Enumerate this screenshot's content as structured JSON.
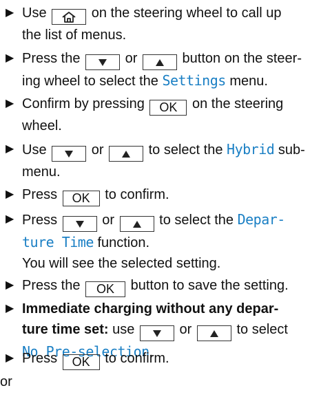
{
  "steps": [
    {
      "a": "Use",
      "b": "on the steering wheel to call up",
      "c": "the list of menus."
    },
    {
      "a": "Press the",
      "or": "or",
      "b": "button on the steer-",
      "c": "ing wheel to select the",
      "ui": "Settings",
      "d": "menu."
    },
    {
      "a": "Confirm by pressing",
      "ok": "OK",
      "b": "on the steering",
      "c": "wheel."
    },
    {
      "a": "Use",
      "or": "or",
      "b": "to select the",
      "ui": "Hybrid",
      "c": "sub-",
      "d": "menu."
    },
    {
      "a": "Press",
      "ok": "OK",
      "b": "to confirm."
    },
    {
      "a": "Press",
      "or": "or",
      "b": "to select the",
      "ui1": "Depar-",
      "ui2": "ture Time",
      "c": "function.",
      "d": "You will see the selected setting."
    },
    {
      "a": "Press the",
      "ok": "OK",
      "b": "button to save the setting."
    },
    {
      "bold1": "Immediate charging without any depar-",
      "bold2": "ture time set:",
      "a": "use",
      "or": "or",
      "b": "to select",
      "ui": "No Pre-selection",
      "c": "."
    },
    {
      "a": "Press",
      "ok": "OK",
      "b": "to confirm."
    }
  ],
  "bullet": "▶",
  "or_line": "or",
  "icons": [
    "home-icon",
    "down-arrow-icon",
    "up-arrow-icon"
  ],
  "colors": {
    "ui_text": "#1a7fc4"
  }
}
